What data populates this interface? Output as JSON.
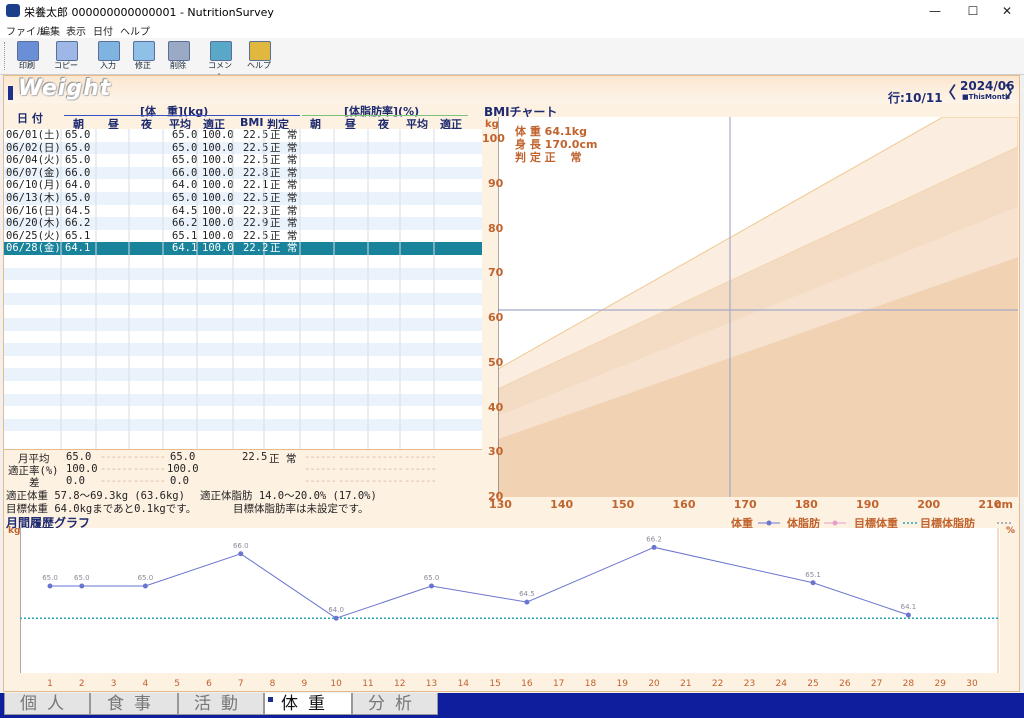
{
  "window": {
    "title": "栄養太郎 000000000000001 - NutritionSurvey",
    "min": "—",
    "max": "☐",
    "close": "✕"
  },
  "menu": [
    "ファイル",
    "編集",
    "表示",
    "日付",
    "ヘルプ"
  ],
  "toolbar": [
    {
      "label": "印刷",
      "icon": "printer-icon",
      "color": "#6b8fd6"
    },
    {
      "label": "コピー",
      "icon": "copy-icon",
      "color": "#9fb7e6"
    },
    {
      "label": "入力",
      "icon": "input-icon",
      "color": "#7fb3e0"
    },
    {
      "label": "修正",
      "icon": "edit-icon",
      "color": "#8fc1e8"
    },
    {
      "label": "削除",
      "icon": "trash-icon",
      "color": "#9aa9c4"
    },
    {
      "label": "コメント",
      "icon": "comment-icon",
      "color": "#5aa8c8"
    },
    {
      "label": "ヘルプ",
      "icon": "help-icon",
      "color": "#e0b840"
    }
  ],
  "header": {
    "title": "Weight",
    "row_label": "行:10/11",
    "prev": "〈",
    "next": "〉",
    "month": "2024/06",
    "this_month": "■ThisMonth"
  },
  "table": {
    "date_header": "日 付",
    "weight_group": "[体　重](kg)",
    "fat_group": "[体脂肪率](%)",
    "weight_cols": [
      "朝",
      "昼",
      "夜",
      "平均",
      "適正",
      "BMI",
      "判定"
    ],
    "fat_cols": [
      "朝",
      "昼",
      "夜",
      "平均",
      "適正"
    ],
    "rows": [
      {
        "date": "06/01(土)",
        "am": "65.0",
        "avg": "65.0",
        "std": "100.0",
        "bmi": "22.5",
        "judge": "正 常"
      },
      {
        "date": "06/02(日)",
        "am": "65.0",
        "avg": "65.0",
        "std": "100.0",
        "bmi": "22.5",
        "judge": "正 常"
      },
      {
        "date": "06/04(火)",
        "am": "65.0",
        "avg": "65.0",
        "std": "100.0",
        "bmi": "22.5",
        "judge": "正 常"
      },
      {
        "date": "06/07(金)",
        "am": "66.0",
        "avg": "66.0",
        "std": "100.0",
        "bmi": "22.8",
        "judge": "正 常"
      },
      {
        "date": "06/10(月)",
        "am": "64.0",
        "avg": "64.0",
        "std": "100.0",
        "bmi": "22.1",
        "judge": "正 常"
      },
      {
        "date": "06/13(木)",
        "am": "65.0",
        "avg": "65.0",
        "std": "100.0",
        "bmi": "22.5",
        "judge": "正 常"
      },
      {
        "date": "06/16(日)",
        "am": "64.5",
        "avg": "64.5",
        "std": "100.0",
        "bmi": "22.3",
        "judge": "正 常"
      },
      {
        "date": "06/20(木)",
        "am": "66.2",
        "avg": "66.2",
        "std": "100.0",
        "bmi": "22.9",
        "judge": "正 常"
      },
      {
        "date": "06/25(火)",
        "am": "65.1",
        "avg": "65.1",
        "std": "100.0",
        "bmi": "22.5",
        "judge": "正 常"
      },
      {
        "date": "06/28(金)",
        "am": "64.1",
        "avg": "64.1",
        "std": "100.0",
        "bmi": "22.2",
        "judge": "正 常"
      }
    ],
    "selected_index": 9,
    "summary": {
      "avg_label": "月平均",
      "avg_am": "65.0",
      "avg_avg": "65.0",
      "avg_bmi": "22.5",
      "avg_judge": "正 常",
      "rate_label": "適正率(%)",
      "rate_am": "100.0",
      "rate_avg": "100.0",
      "diff_label": "差",
      "diff_am": "0.0",
      "diff_avg": "0.0",
      "dashes": "------"
    },
    "info1": "適正体重 57.8～69.3kg (63.6kg)",
    "info2": "適正体脂肪 14.0～20.0% (17.0%)",
    "info3": "目標体重 64.0kgまであと0.1kgです。",
    "info4": "目標体脂肪率は未設定です。"
  },
  "bmi_chart": {
    "title": "BMIチャート",
    "y_unit": "kg",
    "x_unit": "cm",
    "weight_line": "体 重 64.1kg",
    "height_line": "身 長 170.0cm",
    "judge_line": "判 定 正　 常",
    "yticks": [
      "100",
      "90",
      "80",
      "70",
      "60",
      "50",
      "40",
      "30",
      "20"
    ],
    "xticks": [
      "130",
      "140",
      "150",
      "160",
      "170",
      "180",
      "190",
      "200",
      "210"
    ]
  },
  "chart_data": {
    "type": "line",
    "title": "月間履歴グラフ",
    "y_unit_left": "kg",
    "y_unit_right": "%",
    "legend": [
      "体重",
      "体脂肪",
      "目標体重",
      "目標体脂肪"
    ],
    "colors": {
      "weight": "#6a75d0",
      "fat": "#e8a0c8",
      "target": "#2aa5b8"
    },
    "x": [
      1,
      2,
      4,
      7,
      10,
      13,
      16,
      20,
      25,
      28
    ],
    "values": [
      65.0,
      65.0,
      65.0,
      66.0,
      64.0,
      65.0,
      64.5,
      66.2,
      65.1,
      64.1
    ],
    "labels": [
      "65.0",
      "65.0",
      "65.0",
      "66.0",
      "64.0",
      "65.0",
      "64.5",
      "66.2",
      "65.1",
      "64.1"
    ],
    "target_weight": 64.0,
    "xticks": [
      "1",
      "2",
      "3",
      "4",
      "5",
      "6",
      "7",
      "8",
      "9",
      "10",
      "11",
      "12",
      "13",
      "14",
      "15",
      "16",
      "17",
      "18",
      "19",
      "20",
      "21",
      "22",
      "23",
      "24",
      "25",
      "26",
      "27",
      "28",
      "29",
      "30"
    ],
    "yticks": [
      "66",
      "65",
      "64",
      "63"
    ],
    "ylim": [
      62.3,
      66.8
    ]
  },
  "tabs": [
    "個人",
    "食事",
    "活動",
    "体重",
    "分析"
  ],
  "active_tab": 3
}
